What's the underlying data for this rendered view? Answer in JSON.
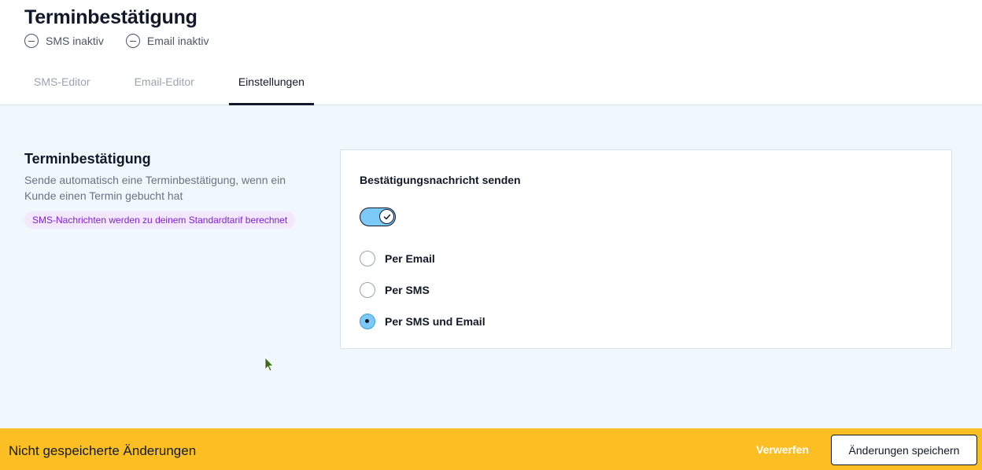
{
  "header": {
    "title": "Terminbestätigung",
    "statuses": [
      {
        "label": "SMS inaktiv",
        "icon": "minus-circle-icon"
      },
      {
        "label": "Email inaktiv",
        "icon": "minus-circle-icon"
      }
    ],
    "tabs": [
      {
        "label": "SMS-Editor",
        "active": false
      },
      {
        "label": "Email-Editor",
        "active": false
      },
      {
        "label": "Einstellungen",
        "active": true
      }
    ]
  },
  "section": {
    "title": "Terminbestätigung",
    "description": "Sende automatisch eine Terminbestätigung, wenn ein Kunde einen Termin gebucht hat",
    "badge": "SMS-Nachrichten werden zu deinem Standardtarif berechnet"
  },
  "card": {
    "title": "Bestätigungsnachricht senden",
    "toggle_on": true,
    "options": [
      {
        "label": "Per Email",
        "checked": false
      },
      {
        "label": "Per SMS",
        "checked": false
      },
      {
        "label": "Per SMS und Email",
        "checked": true
      }
    ]
  },
  "footer": {
    "message": "Nicht gespeicherte Änderungen",
    "discard_label": "Verwerfen",
    "save_label": "Änderungen speichern"
  },
  "colors": {
    "accent_yellow": "#fbbf24",
    "toggle_blue": "#7dc9f7",
    "badge_purple_bg": "#f3e8ff",
    "badge_purple_text": "#7e22ce",
    "content_bg": "#f0f7fd"
  }
}
